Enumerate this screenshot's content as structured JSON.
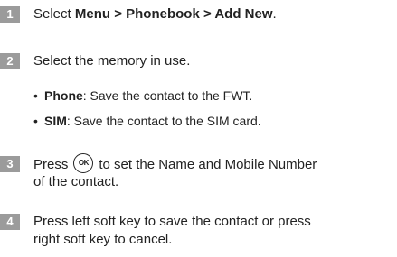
{
  "steps": [
    {
      "number": "1",
      "prefix": "Select ",
      "bold": "Menu > Phonebook > Add New",
      "suffix": "."
    },
    {
      "number": "2",
      "text": "Select the memory in use.",
      "bullets": [
        {
          "dot": "•",
          "term": "Phone",
          "desc": ": Save the contact to the FWT."
        },
        {
          "dot": "•",
          "term": "SIM",
          "desc": ": Save the contact to the SIM card."
        }
      ]
    },
    {
      "number": "3",
      "prefix": "Press",
      "icon_label": "OK",
      "icon_name": "ok-key-icon",
      "suffix": "to set the Name and Mobile Number",
      "line2": "of the contact."
    },
    {
      "number": "4",
      "line1": "Press left soft key to save the contact or press",
      "line2": "right soft key to cancel."
    }
  ]
}
